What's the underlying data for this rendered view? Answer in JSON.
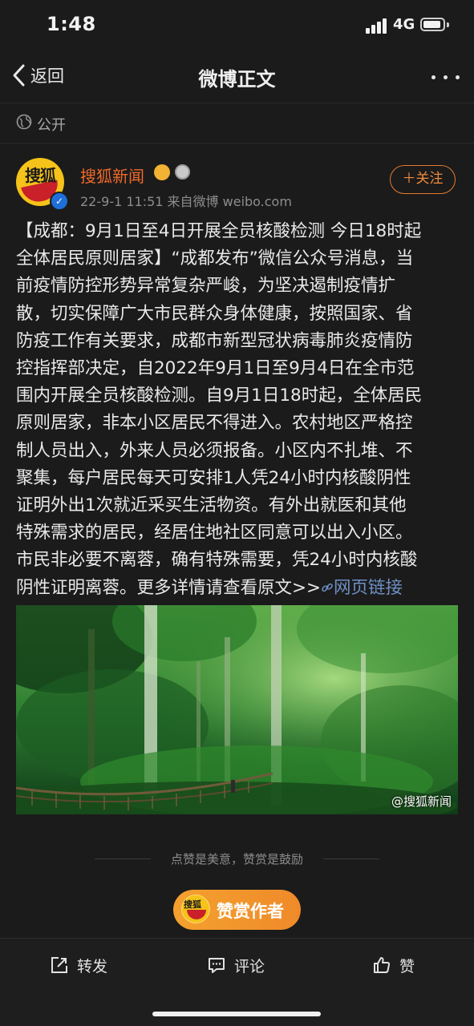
{
  "status_bar": {
    "time": "1:48",
    "network": "4G",
    "battery_level": 0.9
  },
  "nav": {
    "back_label": "返回",
    "title": "微博正文",
    "more_icon": "more-dots-icon"
  },
  "visibility": {
    "label": "公开",
    "icon": "globe-icon"
  },
  "author": {
    "avatar_text": "搜狐",
    "name": "搜狐新闻",
    "meta": "22-9-1 11:51  来自微博 weibo.com",
    "follow_label": "＋关注",
    "verified": true
  },
  "post": {
    "lines": [
      "【成都：9月1日至4日开展全员核酸检测 今日18时起",
      "全体居民原则居家】“成都发布”微信公众号消息，当",
      "前疫情防控形势异常复杂严峻，为坚决遏制疫情扩",
      "散，切实保障广大市民群众身体健康，按照国家、省",
      "防疫工作有关要求，成都市新型冠状病毒肺炎疫情防",
      "控指挥部决定，自2022年9月1日至9月4日在全市范",
      "围内开展全员核酸检测。自9月1日18时起，全体居民",
      "原则居家，非本小区居民不得进入。农村地区严格控",
      "制人员出入，外来人员必须报备。小区内不扎堆、不",
      "聚集，每户居民每天可安排1人凭24小时内核酸阴性",
      "证明外出1次就近采买生活物资。有外出就医和其他",
      "特殊需求的居民，经居住地社区同意可以出入小区。",
      "市民非必要不离蓉，确有特殊需要，凭24小时内核酸"
    ],
    "last_line": "阴性证明离蓉。更多详情请查看原文>>",
    "link_label": "网页链接",
    "image_watermark": "@搜狐新闻"
  },
  "reward": {
    "hint": "点赞是美意，赞赏是鼓励",
    "button_label": "赞赏作者",
    "avatar_text": "搜狐"
  },
  "actions": {
    "repost": "转发",
    "comment": "评论",
    "like": "赞"
  },
  "colors": {
    "accent": "#f06a2a",
    "link": "#6e8fc4",
    "background": "#1b1b1b"
  }
}
